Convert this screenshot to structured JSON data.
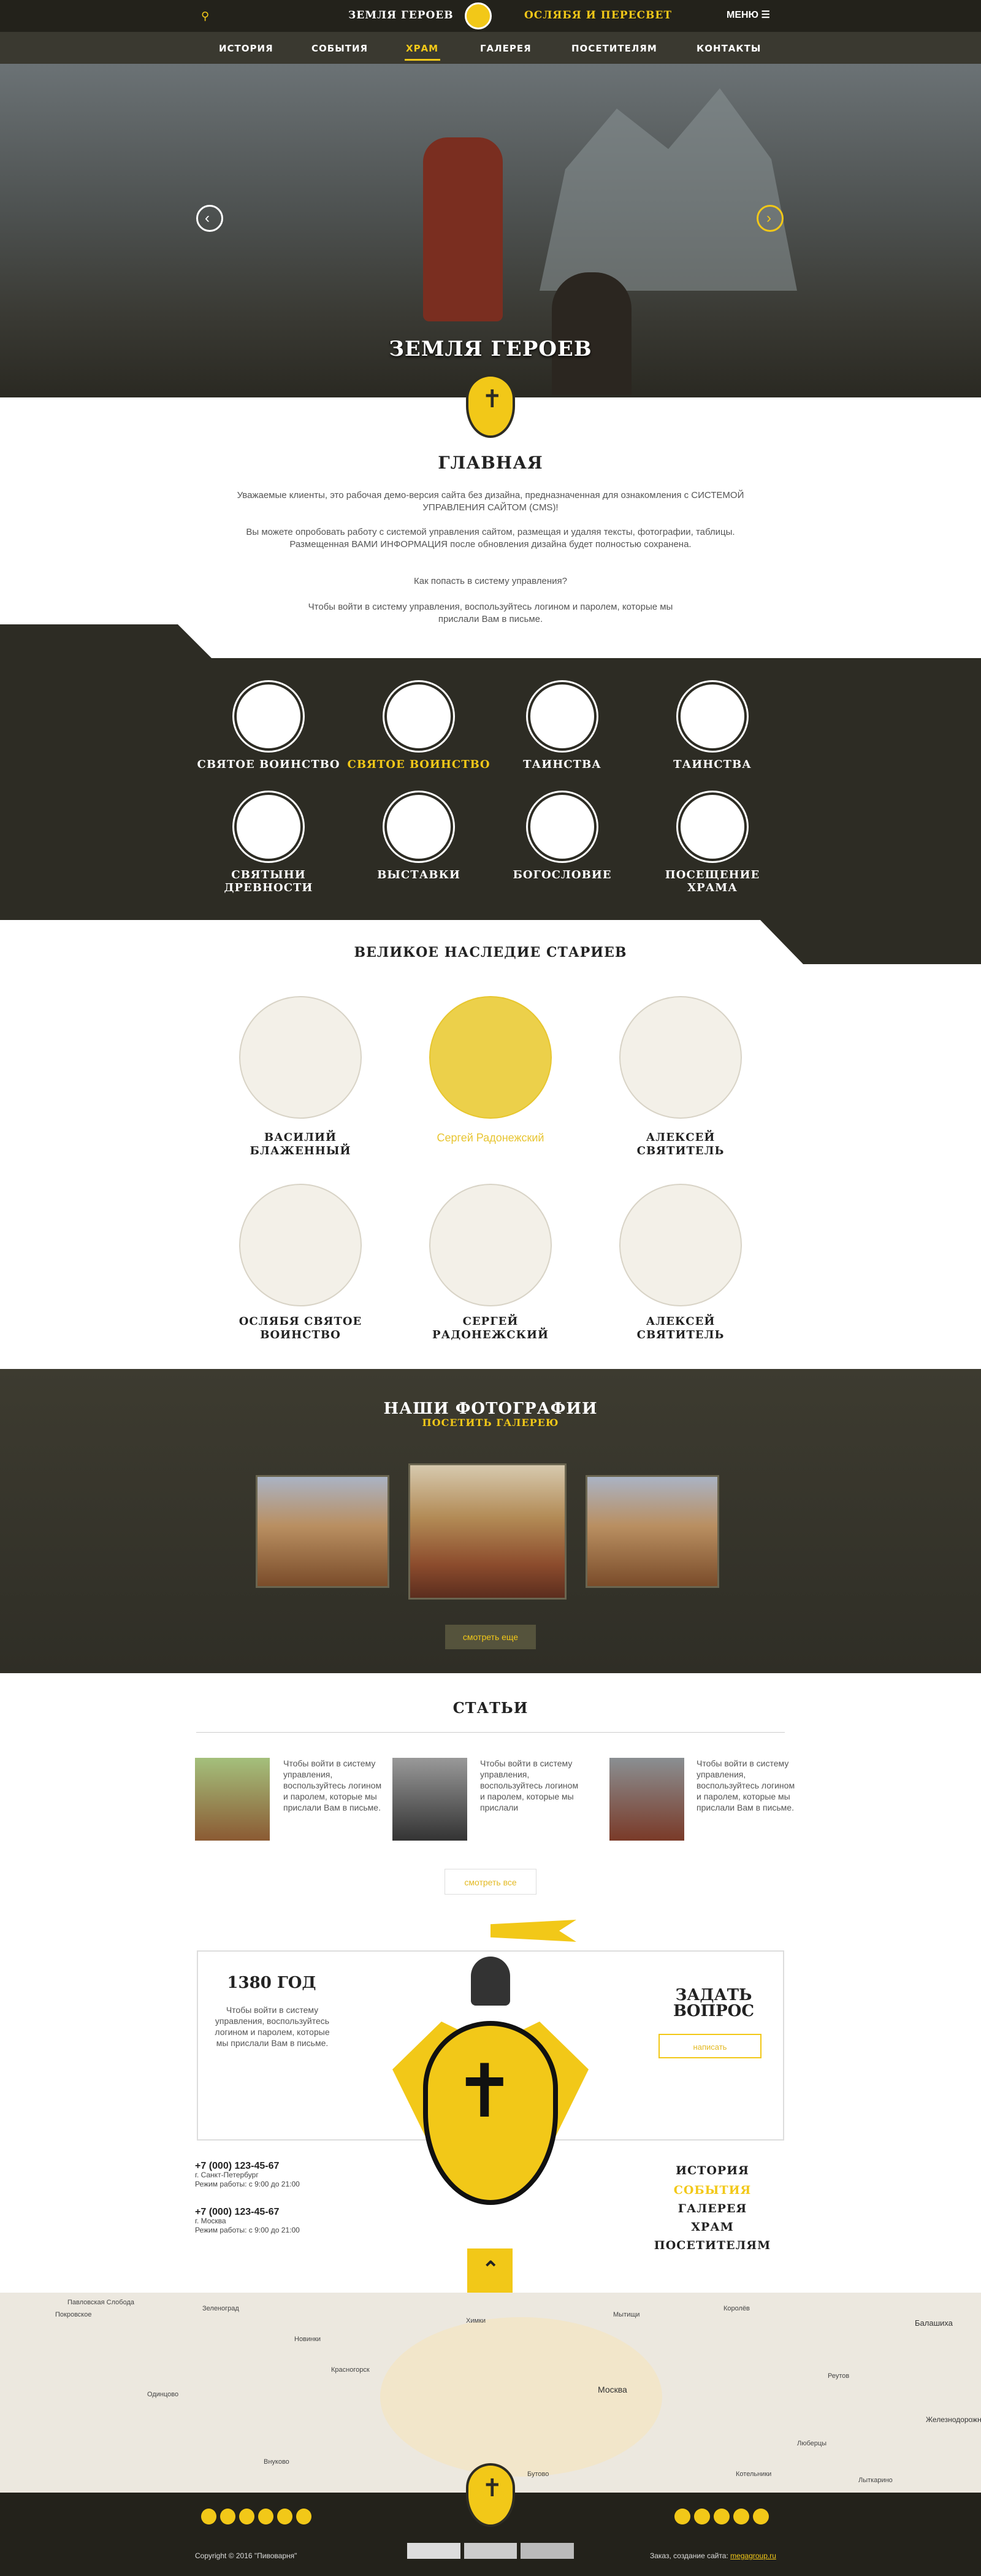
{
  "header": {
    "brand": "Земля героев",
    "brand2": "Ослябя и Пересвет",
    "menu_label": "МЕНЮ"
  },
  "nav": [
    "История",
    "События",
    "Храм",
    "Галерея",
    "Посетителям",
    "Контакты"
  ],
  "hero": {
    "title": "Земля героев"
  },
  "intro": {
    "title": "Главная",
    "p1": "Уважаемые клиенты, это рабочая демо-версия сайта без дизайна, предназначенная для ознакомления с СИСТЕМОЙ УПРАВЛЕНИЯ САЙТОМ (CMS)!",
    "p2": "Вы можете опробовать работу с системой управления сайтом, размещая и удаляя тексты, фотографии, таблицы. Размещенная ВАМИ ИНФОРМАЦИЯ после обновления дизайна будет полностью сохранена.",
    "p3": "Как попасть в систему управления?",
    "p4": "Чтобы войти в систему управления, воспользуйтесь логином и паролем, которые мы прислали Вам в письме."
  },
  "categories": [
    "Святое воинство",
    "Святое воинство",
    "Таинства",
    "Таинства",
    "Святыни древности",
    "Выставки",
    "Богословие",
    "Посещение храма"
  ],
  "heritage": {
    "title": "Великое наследие стариев",
    "saints": [
      "Василий Блаженный",
      "Сергей Радонежский",
      "Алексей Святитель",
      "Ослябя святое воинство",
      "Сергей Радонежский",
      "Алексей Святитель"
    ]
  },
  "photos": {
    "title": "Наши фотографии",
    "subtitle": "Посетить галерею",
    "more": "смотреть еще"
  },
  "articles": {
    "title": "Статьи",
    "items": [
      "Чтобы войти в систему управления, воспользуйтесь логином и паролем, которые мы прислали Вам в письме.",
      "Чтобы войти в систему управления, воспользуйтесь логином и паролем, которые мы прислали",
      "Чтобы войти в систему управления, воспользуйтесь логином и паролем, которые мы прислали Вам в письме."
    ],
    "all": "смотреть все"
  },
  "info": {
    "year": "1380 год",
    "year_text": "Чтобы войти в систему управления, воспользуйтесь логином и паролем, которые мы прислали Вам в письме.",
    "ask": "Задать вопрос",
    "ask_btn": "написать"
  },
  "contacts": [
    {
      "phone": "+7 (000) 123-45-67",
      "city": "г. Санкт-Петербург",
      "hours": "Режим работы: с 9:00 до 21:00"
    },
    {
      "phone": "+7 (000) 123-45-67",
      "city": "г. Москва",
      "hours": "Режим работы: с 9:00 до 21:00"
    }
  ],
  "footer_nav": [
    "История",
    "События",
    "Галерея",
    "Храм",
    "Посетителям"
  ],
  "map": {
    "labels": [
      "Павловская Слобода",
      "Покровское",
      "Зеленоград",
      "Новинки",
      "Москва",
      "Балашиха",
      "Химки",
      "Мытищи",
      "Королёв",
      "Реутов",
      "Люберцы",
      "Железнодорожный",
      "Красногорск",
      "Одинцово",
      "Внуково",
      "Бутово",
      "Котельники",
      "Лыткарино"
    ]
  },
  "footer": {
    "copyright": "Copyright © 2016 \"Пивоварня\"",
    "order": "Заказ, создание сайта:",
    "order_link": "megagroup.ru"
  },
  "colors": {
    "accent": "#f2c818",
    "dark": "#2d2c24"
  }
}
